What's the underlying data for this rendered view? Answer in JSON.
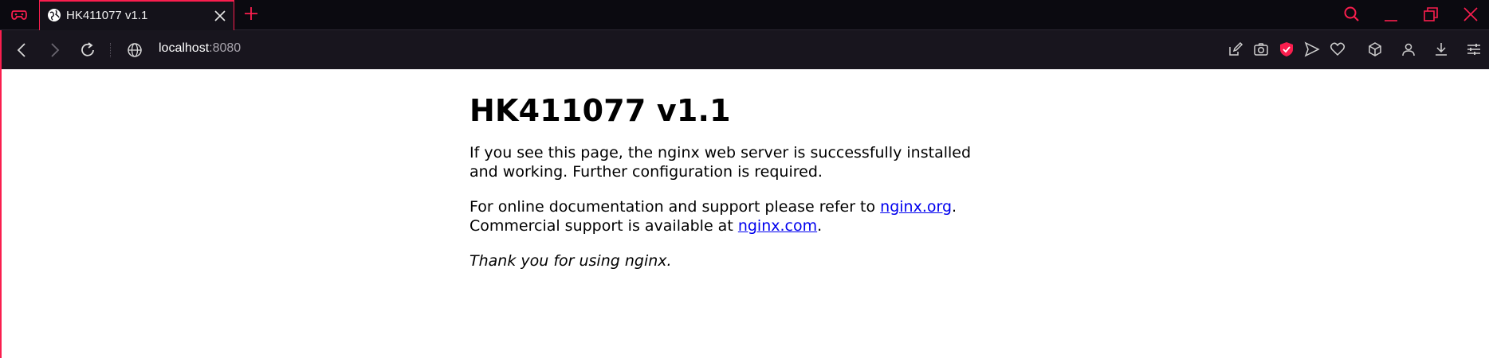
{
  "browser": {
    "tab": {
      "title": "HK411077 v1.1"
    },
    "address": {
      "host": "localhost",
      "port": ":8080"
    },
    "colors": {
      "accent": "#fa1e4e",
      "chrome_bg": "#0b0a10",
      "toolbar_bg": "#18151e"
    },
    "icons": {
      "logo": "gx-controller-icon",
      "favicon": "globe-icon",
      "close": "close-icon",
      "new_tab": "plus-icon",
      "search": "search-icon",
      "minimize": "minimize-icon",
      "restore": "restore-icon",
      "window_close": "window-close-icon",
      "tools": [
        "edit-icon",
        "camera-icon",
        "shield-icon",
        "send-icon",
        "heart-icon",
        "cube-icon",
        "profile-icon",
        "download-icon",
        "settings-sliders-icon"
      ]
    }
  },
  "page": {
    "heading": "HK411077 v1.1",
    "para1": "If you see this page, the nginx web server is successfully installed and working. Further configuration is required.",
    "para2_text1": "For online documentation and support please refer to ",
    "para2_link1": "nginx.org",
    "para2_text2": ".",
    "para2_text3": "Commercial support is available at ",
    "para2_link2": "nginx.com",
    "para2_text4": ".",
    "thanks": "Thank you for using nginx."
  }
}
